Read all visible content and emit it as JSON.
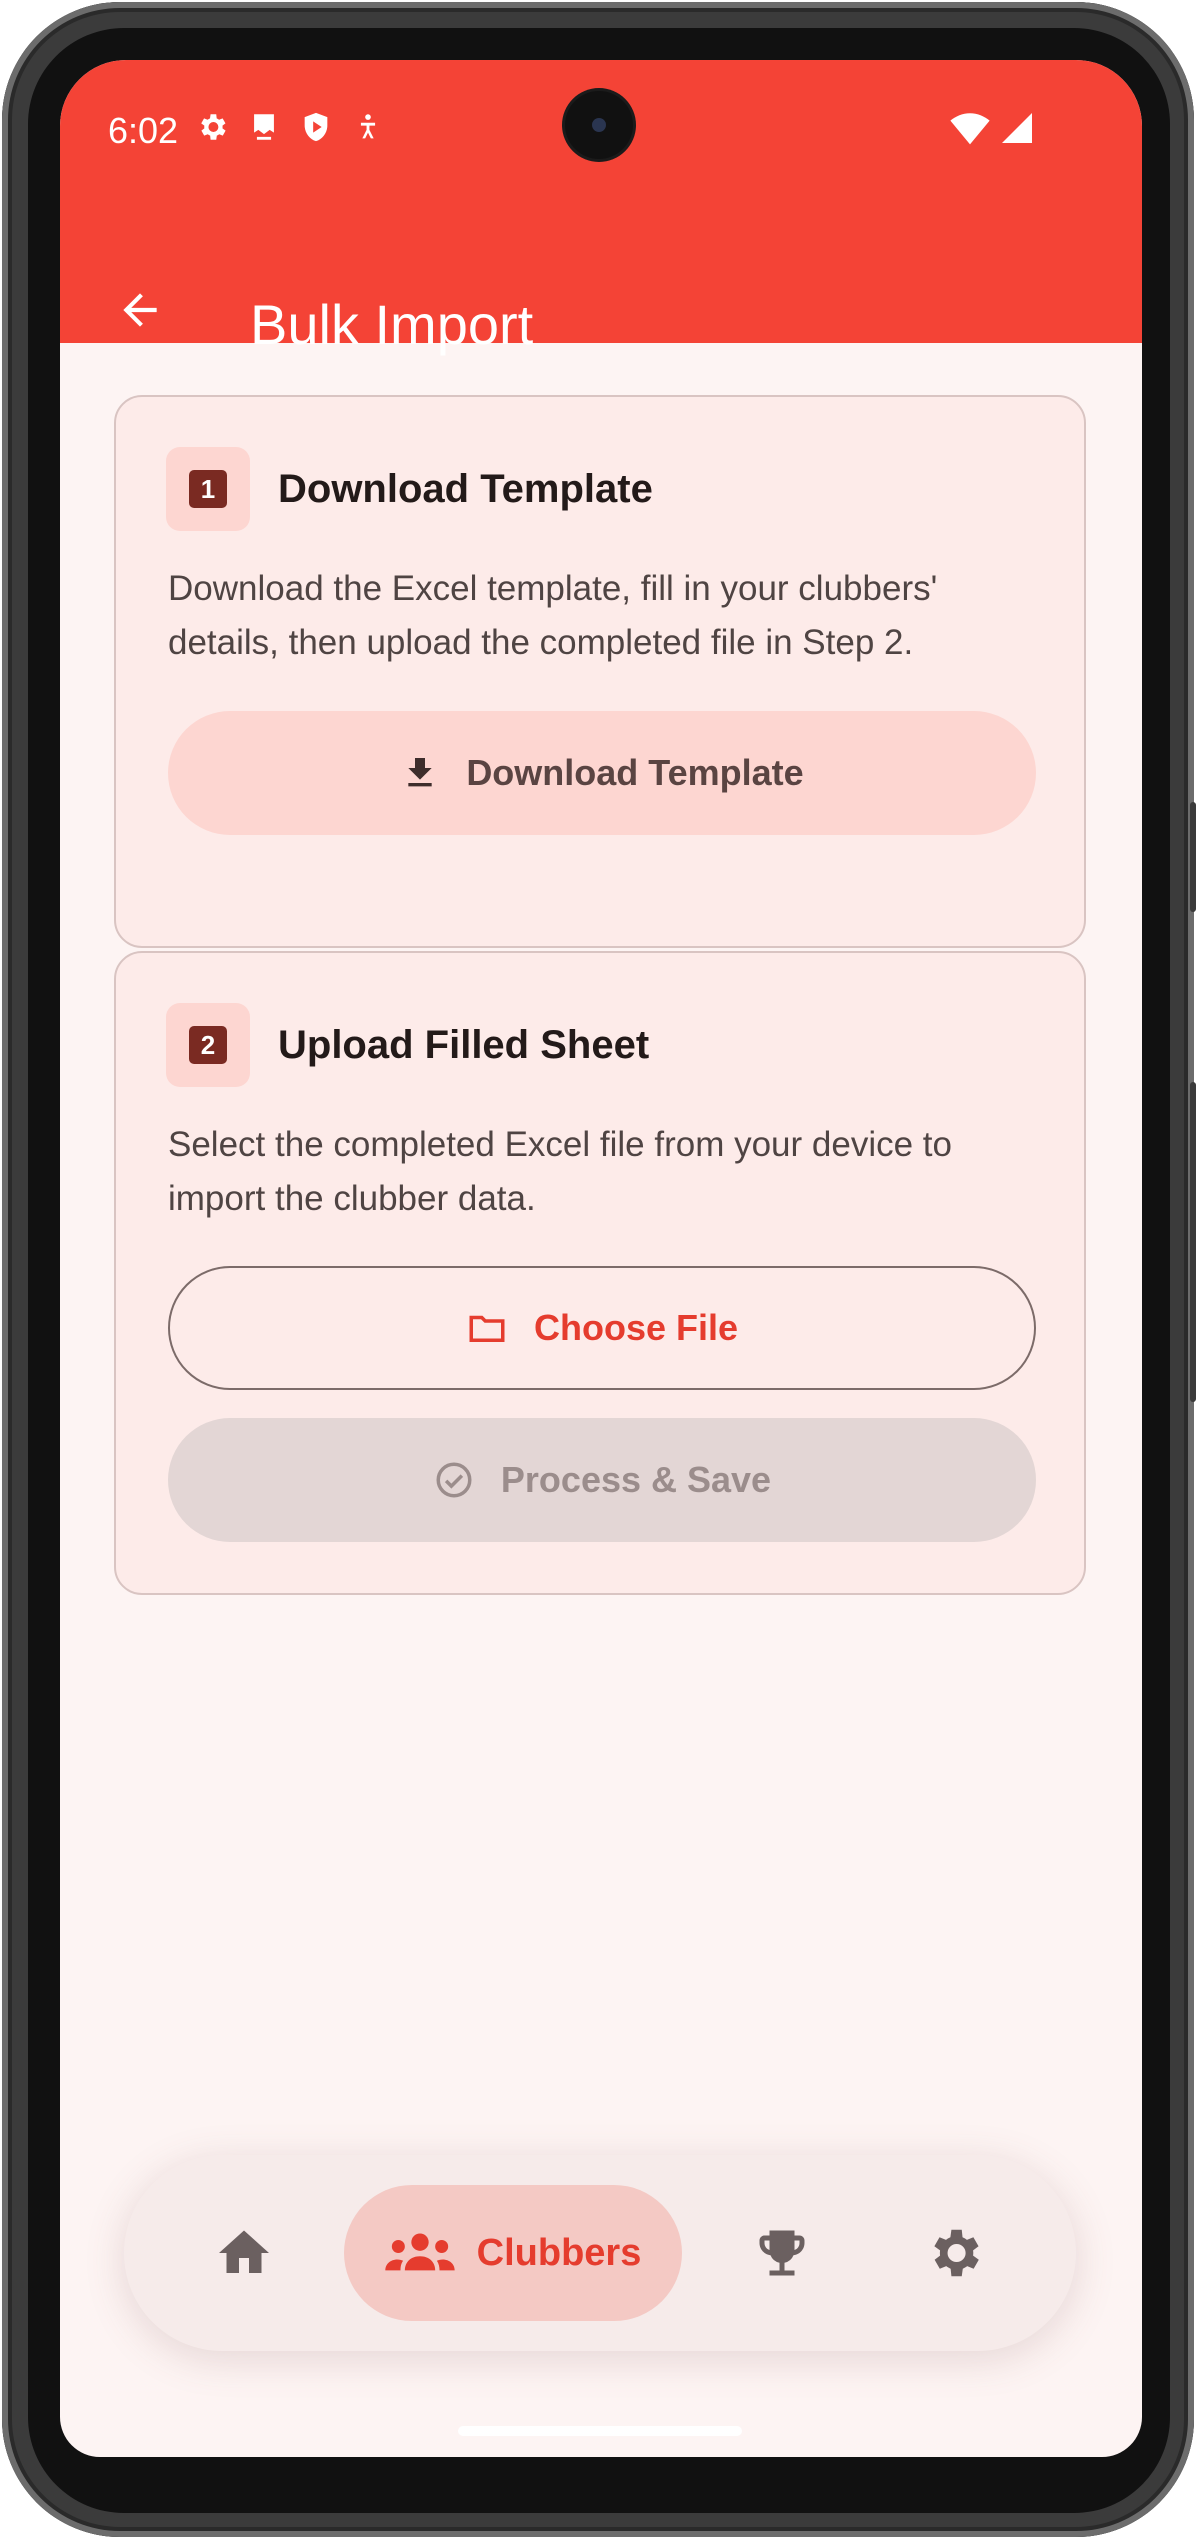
{
  "status_bar": {
    "time": "6:02"
  },
  "app_bar": {
    "title": "Bulk Import"
  },
  "steps": [
    {
      "number": "1",
      "title": "Download Template",
      "description": "Download the Excel template, fill in your clubbers' details, then upload the completed file in Step 2.",
      "button_label": "Download Template"
    },
    {
      "number": "2",
      "title": "Upload Filled Sheet",
      "description": "Select the completed Excel file from your device to import the clubber data.",
      "choose_label": "Choose File",
      "process_label": "Process & Save"
    }
  ],
  "bottom_nav": {
    "items": [
      {
        "icon": "home-icon"
      },
      {
        "icon": "groups-icon",
        "label": "Clubbers",
        "selected": true
      },
      {
        "icon": "trophy-icon"
      },
      {
        "icon": "settings-icon"
      }
    ]
  },
  "colors": {
    "primary": "#f44336",
    "accent_text": "#e53c2e",
    "background": "#fdf4f3",
    "card": "#fdebe9"
  }
}
